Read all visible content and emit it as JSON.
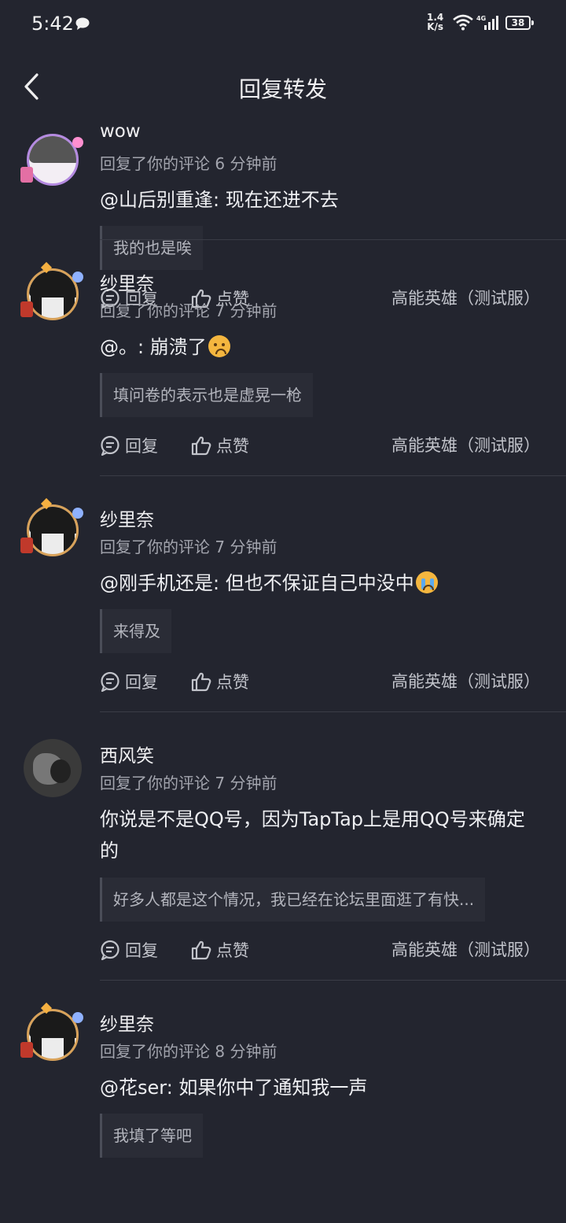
{
  "status_bar": {
    "time": "5:42",
    "net_speed_value": "1.4",
    "net_speed_unit": "K/s",
    "battery": "38",
    "network": "4G"
  },
  "nav": {
    "title": "回复转发"
  },
  "actions": {
    "reply_label": "回复",
    "like_label": "点赞"
  },
  "cards": [
    {
      "username": "wow",
      "meta": "回复了你的评论 6 分钟前",
      "message": "@山后别重逢: 现在还进不去",
      "quote": "我的也是唉",
      "game": "高能英雄（测试服）"
    },
    {
      "username": "纱里奈",
      "meta": "回复了你的评论 7 分钟前",
      "message": "@。: 崩溃了",
      "message_emoji": "upside-down-face-emoji",
      "quote": "填问卷的表示也是虚晃一枪",
      "game": "高能英雄（测试服）"
    },
    {
      "username": "纱里奈",
      "meta": "回复了你的评论 7 分钟前",
      "message": "@刚手机还是: 但也不保证自己中没中",
      "message_emoji": "crying-face-emoji",
      "quote": "来得及",
      "game": "高能英雄（测试服）"
    },
    {
      "username": "西风笑",
      "meta": "回复了你的评论 7 分钟前",
      "message": "你说是不是QQ号，因为TapTap上是用QQ号来确定的",
      "quote": "好多人都是这个情况，我已经在论坛里面逛了有快...",
      "game": "高能英雄（测试服）"
    },
    {
      "username": "纱里奈",
      "meta": "回复了你的评论 8 分钟前",
      "message": "@花ser: 如果你中了通知我一声",
      "quote": "我填了等吧"
    }
  ]
}
